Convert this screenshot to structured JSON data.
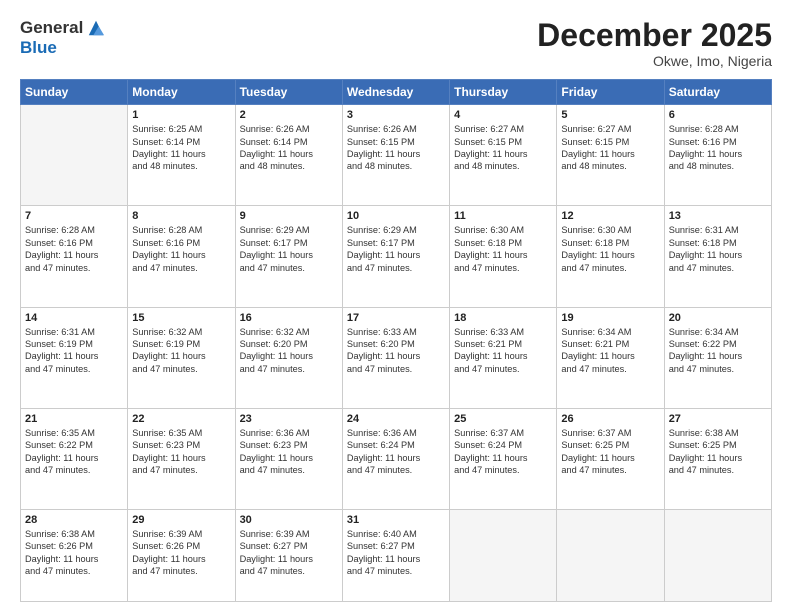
{
  "logo": {
    "general": "General",
    "blue": "Blue"
  },
  "title": "December 2025",
  "location": "Okwe, Imo, Nigeria",
  "days_header": [
    "Sunday",
    "Monday",
    "Tuesday",
    "Wednesday",
    "Thursday",
    "Friday",
    "Saturday"
  ],
  "weeks": [
    [
      {
        "num": "",
        "empty": true
      },
      {
        "num": "1",
        "sunrise": "Sunrise: 6:25 AM",
        "sunset": "Sunset: 6:14 PM",
        "daylight": "Daylight: 11 hours and 48 minutes."
      },
      {
        "num": "2",
        "sunrise": "Sunrise: 6:26 AM",
        "sunset": "Sunset: 6:14 PM",
        "daylight": "Daylight: 11 hours and 48 minutes."
      },
      {
        "num": "3",
        "sunrise": "Sunrise: 6:26 AM",
        "sunset": "Sunset: 6:15 PM",
        "daylight": "Daylight: 11 hours and 48 minutes."
      },
      {
        "num": "4",
        "sunrise": "Sunrise: 6:27 AM",
        "sunset": "Sunset: 6:15 PM",
        "daylight": "Daylight: 11 hours and 48 minutes."
      },
      {
        "num": "5",
        "sunrise": "Sunrise: 6:27 AM",
        "sunset": "Sunset: 6:15 PM",
        "daylight": "Daylight: 11 hours and 48 minutes."
      },
      {
        "num": "6",
        "sunrise": "Sunrise: 6:28 AM",
        "sunset": "Sunset: 6:16 PM",
        "daylight": "Daylight: 11 hours and 48 minutes."
      }
    ],
    [
      {
        "num": "7",
        "sunrise": "Sunrise: 6:28 AM",
        "sunset": "Sunset: 6:16 PM",
        "daylight": "Daylight: 11 hours and 47 minutes."
      },
      {
        "num": "8",
        "sunrise": "Sunrise: 6:28 AM",
        "sunset": "Sunset: 6:16 PM",
        "daylight": "Daylight: 11 hours and 47 minutes."
      },
      {
        "num": "9",
        "sunrise": "Sunrise: 6:29 AM",
        "sunset": "Sunset: 6:17 PM",
        "daylight": "Daylight: 11 hours and 47 minutes."
      },
      {
        "num": "10",
        "sunrise": "Sunrise: 6:29 AM",
        "sunset": "Sunset: 6:17 PM",
        "daylight": "Daylight: 11 hours and 47 minutes."
      },
      {
        "num": "11",
        "sunrise": "Sunrise: 6:30 AM",
        "sunset": "Sunset: 6:18 PM",
        "daylight": "Daylight: 11 hours and 47 minutes."
      },
      {
        "num": "12",
        "sunrise": "Sunrise: 6:30 AM",
        "sunset": "Sunset: 6:18 PM",
        "daylight": "Daylight: 11 hours and 47 minutes."
      },
      {
        "num": "13",
        "sunrise": "Sunrise: 6:31 AM",
        "sunset": "Sunset: 6:18 PM",
        "daylight": "Daylight: 11 hours and 47 minutes."
      }
    ],
    [
      {
        "num": "14",
        "sunrise": "Sunrise: 6:31 AM",
        "sunset": "Sunset: 6:19 PM",
        "daylight": "Daylight: 11 hours and 47 minutes."
      },
      {
        "num": "15",
        "sunrise": "Sunrise: 6:32 AM",
        "sunset": "Sunset: 6:19 PM",
        "daylight": "Daylight: 11 hours and 47 minutes."
      },
      {
        "num": "16",
        "sunrise": "Sunrise: 6:32 AM",
        "sunset": "Sunset: 6:20 PM",
        "daylight": "Daylight: 11 hours and 47 minutes."
      },
      {
        "num": "17",
        "sunrise": "Sunrise: 6:33 AM",
        "sunset": "Sunset: 6:20 PM",
        "daylight": "Daylight: 11 hours and 47 minutes."
      },
      {
        "num": "18",
        "sunrise": "Sunrise: 6:33 AM",
        "sunset": "Sunset: 6:21 PM",
        "daylight": "Daylight: 11 hours and 47 minutes."
      },
      {
        "num": "19",
        "sunrise": "Sunrise: 6:34 AM",
        "sunset": "Sunset: 6:21 PM",
        "daylight": "Daylight: 11 hours and 47 minutes."
      },
      {
        "num": "20",
        "sunrise": "Sunrise: 6:34 AM",
        "sunset": "Sunset: 6:22 PM",
        "daylight": "Daylight: 11 hours and 47 minutes."
      }
    ],
    [
      {
        "num": "21",
        "sunrise": "Sunrise: 6:35 AM",
        "sunset": "Sunset: 6:22 PM",
        "daylight": "Daylight: 11 hours and 47 minutes."
      },
      {
        "num": "22",
        "sunrise": "Sunrise: 6:35 AM",
        "sunset": "Sunset: 6:23 PM",
        "daylight": "Daylight: 11 hours and 47 minutes."
      },
      {
        "num": "23",
        "sunrise": "Sunrise: 6:36 AM",
        "sunset": "Sunset: 6:23 PM",
        "daylight": "Daylight: 11 hours and 47 minutes."
      },
      {
        "num": "24",
        "sunrise": "Sunrise: 6:36 AM",
        "sunset": "Sunset: 6:24 PM",
        "daylight": "Daylight: 11 hours and 47 minutes."
      },
      {
        "num": "25",
        "sunrise": "Sunrise: 6:37 AM",
        "sunset": "Sunset: 6:24 PM",
        "daylight": "Daylight: 11 hours and 47 minutes."
      },
      {
        "num": "26",
        "sunrise": "Sunrise: 6:37 AM",
        "sunset": "Sunset: 6:25 PM",
        "daylight": "Daylight: 11 hours and 47 minutes."
      },
      {
        "num": "27",
        "sunrise": "Sunrise: 6:38 AM",
        "sunset": "Sunset: 6:25 PM",
        "daylight": "Daylight: 11 hours and 47 minutes."
      }
    ],
    [
      {
        "num": "28",
        "sunrise": "Sunrise: 6:38 AM",
        "sunset": "Sunset: 6:26 PM",
        "daylight": "Daylight: 11 hours and 47 minutes."
      },
      {
        "num": "29",
        "sunrise": "Sunrise: 6:39 AM",
        "sunset": "Sunset: 6:26 PM",
        "daylight": "Daylight: 11 hours and 47 minutes."
      },
      {
        "num": "30",
        "sunrise": "Sunrise: 6:39 AM",
        "sunset": "Sunset: 6:27 PM",
        "daylight": "Daylight: 11 hours and 47 minutes."
      },
      {
        "num": "31",
        "sunrise": "Sunrise: 6:40 AM",
        "sunset": "Sunset: 6:27 PM",
        "daylight": "Daylight: 11 hours and 47 minutes."
      },
      {
        "num": "",
        "empty": true
      },
      {
        "num": "",
        "empty": true
      },
      {
        "num": "",
        "empty": true
      }
    ]
  ]
}
